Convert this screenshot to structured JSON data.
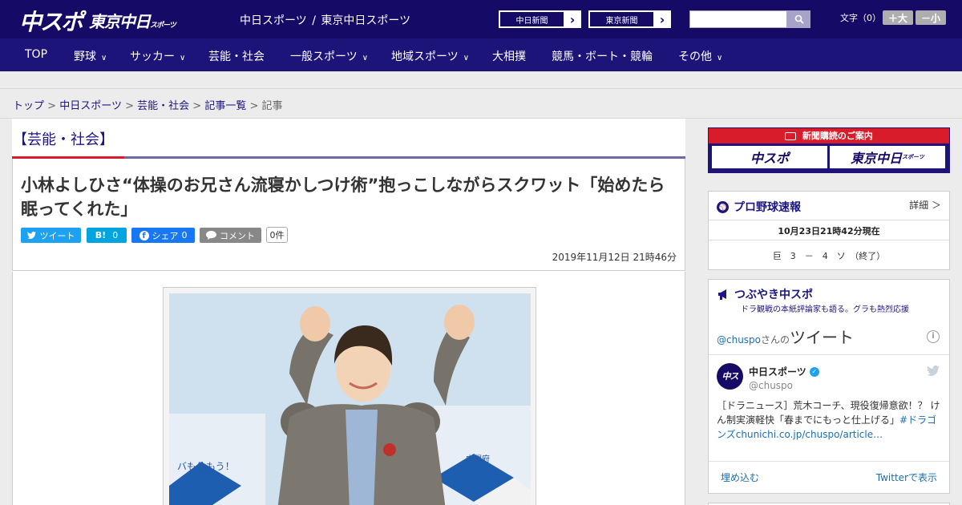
{
  "header": {
    "logo_main": "中スポ",
    "logo_tokyo": "東京中日",
    "logo_tokyo_small": "スポーツ",
    "site_links": [
      "中日スポーツ",
      "東京中日スポーツ"
    ],
    "site_sep": "/",
    "paper_buttons": [
      "中日新聞",
      "東京新聞"
    ],
    "paper_arrow": "›",
    "font_size_label": "文字（0）",
    "font_bigger": "＋大",
    "font_smaller": "－小"
  },
  "nav": {
    "items": [
      {
        "label": "TOP",
        "dropdown": false
      },
      {
        "label": "野球",
        "dropdown": true
      },
      {
        "label": "サッカー",
        "dropdown": true
      },
      {
        "label": "芸能・社会",
        "dropdown": false
      },
      {
        "label": "一般スポーツ",
        "dropdown": true
      },
      {
        "label": "地域スポーツ",
        "dropdown": true
      },
      {
        "label": "大相撲",
        "dropdown": false
      },
      {
        "label": "競馬・ボート・競輪",
        "dropdown": false
      },
      {
        "label": "その他",
        "dropdown": true
      }
    ]
  },
  "breadcrumb": {
    "items": [
      "トップ",
      "中日スポーツ",
      "芸能・社会",
      "記事一覧"
    ],
    "current": "記事",
    "sep": ">"
  },
  "article": {
    "category": "【芸能・社会】",
    "headline": "小林よしひさ“体操のお兄さん流寝かしつけ術”抱っこしながらスクワット「始めたら眠ってくれた」",
    "share": {
      "tweet": "ツイート",
      "hatena": "B!",
      "hatena_count": "0",
      "facebook": "シェア",
      "facebook_count": "0",
      "comment": "コメント",
      "comment_count": "0件"
    },
    "date": "2019年11月12日 21時46分"
  },
  "sidebar": {
    "subscription": {
      "title": "新聞購読のご案内",
      "buttons": [
        "中スポ",
        "東京中日"
      ],
      "button_small": "スポーツ"
    },
    "baseball": {
      "title": "プロ野球速報",
      "detail": "詳細 ＞",
      "updated": "10月23日21時42分現在",
      "score": "巨　3　－　4　ソ　（終了）"
    },
    "tweets": {
      "title": "つぶやき中スポ",
      "subtitle": "ドラ観戦の本紙評論家も語る。グラも熱烈応援",
      "handle_prefix": "@chuspo",
      "handle_suffix": "さんの",
      "tweets_word": "ツイート",
      "account_name": "中日スポーツ",
      "account_handle": "@chuspo",
      "tweet_text": "［ドラニュース］荒木コーチ、現役復帰意欲！？ けん制実演軽快「春までにもっと仕上げる」",
      "tweet_hashtag": "#ドラゴンズ",
      "tweet_link": "chunichi.co.jp/chuspo/article…",
      "embed": "埋め込む",
      "view_on_twitter": "Twitterで表示"
    }
  },
  "colors": {
    "brand_navy": "#150a66",
    "nav_navy": "#1d1479",
    "accent_red": "#d81c2b",
    "twitter_blue": "#1da1f2",
    "hatena_blue": "#00a4de",
    "facebook_blue": "#1877f2",
    "comment_gray": "#888888"
  }
}
